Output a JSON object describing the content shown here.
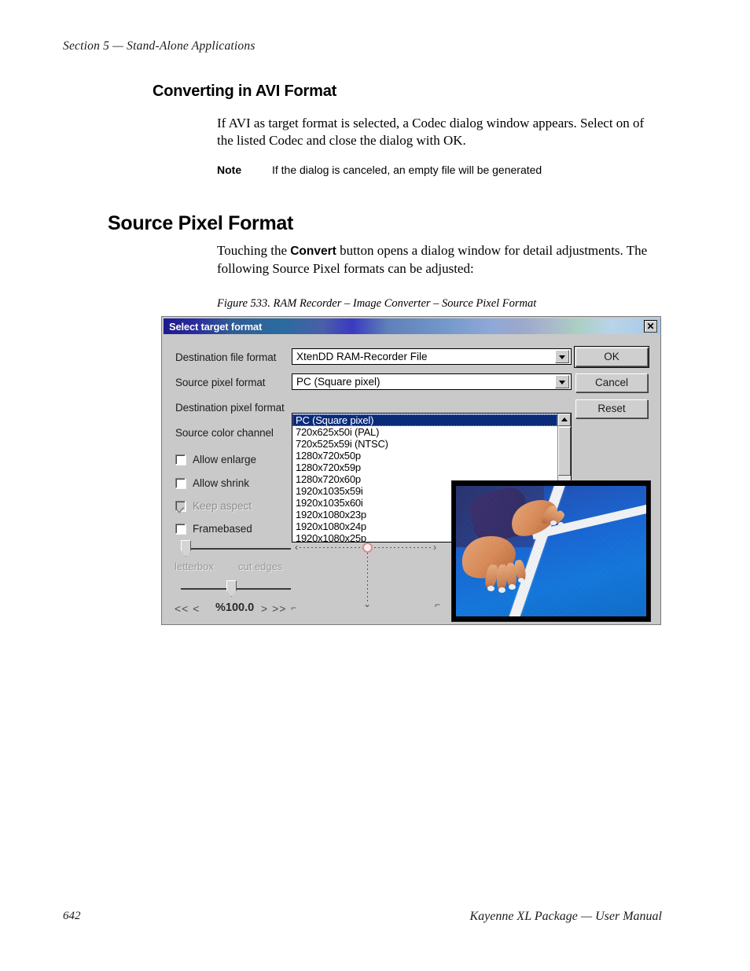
{
  "page": {
    "running_head": "Section 5 — Stand-Alone Applications",
    "footer_page_number": "642",
    "footer_title": "Kayenne XL Package  —  User Manual"
  },
  "sections": {
    "avi": {
      "heading": "Converting in AVI Format",
      "paragraph": "If AVI as target format is selected, a Codec dialog window appears. Select on of the listed Codec and close the dialog with OK.",
      "note_label": "Note",
      "note_text": "If the dialog is canceled, an empty file will be generated"
    },
    "source_pixel_format": {
      "heading": "Source Pixel Format",
      "paragraph_before": "Touching the ",
      "paragraph_bold": "Convert",
      "paragraph_after": " button opens a dialog window for detail adjustments. The following Source Pixel formats can be adjusted:",
      "figure_caption": "Figure 533.  RAM Recorder – Image Converter – Source Pixel Format"
    }
  },
  "dialog": {
    "title": "Select target format",
    "close_glyph": "✕",
    "labels": {
      "destination_file_format": "Destination file format",
      "source_pixel_format": "Source pixel format",
      "destination_pixel_format": "Destination pixel format",
      "source_color_channel": "Source color channel"
    },
    "combos": {
      "destination_file_format_value": "XtenDD RAM-Recorder File",
      "source_pixel_format_value": "PC (Square pixel)"
    },
    "dropdown": {
      "selected": "PC (Square pixel)",
      "items": [
        "PC (Square pixel)",
        "720x625x50i (PAL)",
        "720x525x59i (NTSC)",
        "1280x720x50p",
        "1280x720x59p",
        "1280x720x60p",
        "1920x1035x59i",
        "1920x1035x60i",
        "1920x1080x23p",
        "1920x1080x24p",
        "1920x1080x25p"
      ],
      "scroll_up_glyph": "▲",
      "scroll_down_glyph": "▼"
    },
    "checkboxes": [
      {
        "label": "Allow enlarge",
        "checked": false,
        "disabled": false
      },
      {
        "label": "Allow shrink",
        "checked": false,
        "disabled": false
      },
      {
        "label": "Keep aspect",
        "checked": true,
        "disabled": true
      },
      {
        "label": "Framebased",
        "checked": false,
        "disabled": false
      }
    ],
    "buttons": {
      "ok": "OK",
      "cancel": "Cancel",
      "reset": "Reset"
    },
    "sliders": {
      "crop_left_label": "letterbox",
      "crop_right_label": "cut edges",
      "zoom_value": "%100.0",
      "nav_prev": "<< <",
      "nav_next": "> >>",
      "corner_mark_left": "⌐",
      "corner_mark_right": "⌐"
    },
    "colors": {
      "face": "#c9c9c9",
      "titlebar_start": "#1b1b8f",
      "titlebar_end": "#a8c8e8",
      "selection": "#0a2a7a",
      "disabled_text": "#8e8e8e"
    }
  }
}
